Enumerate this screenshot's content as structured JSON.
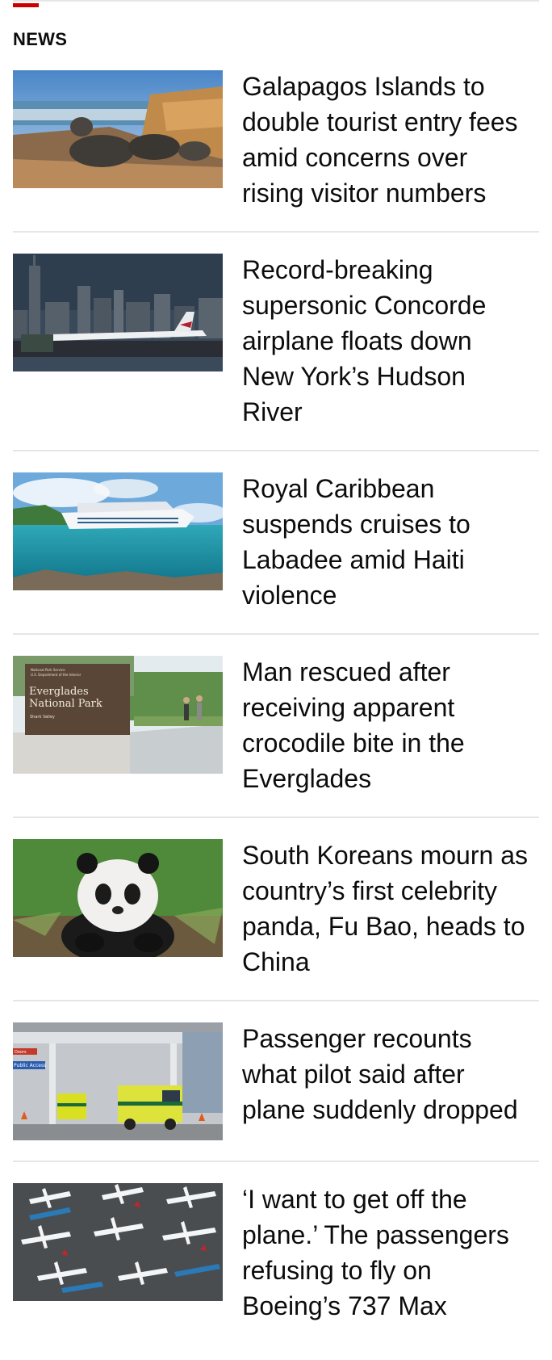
{
  "section": {
    "title": "NEWS",
    "accent_color": "#cc0000"
  },
  "articles": [
    {
      "headline": "Galapagos Islands to double tourist entry fees amid concerns over rising visitor numbers",
      "image": "iguanas-on-rocks-photo"
    },
    {
      "headline": "Record-breaking supersonic Concorde airplane floats down New York’s Hudson River",
      "image": "concorde-on-barge-photo"
    },
    {
      "headline": "Royal Caribbean suspends cruises to Labadee amid Haiti violence",
      "image": "cruise-ship-photo"
    },
    {
      "headline": "Man rescued after receiving apparent crocodile bite in the Everglades",
      "image": "everglades-sign-photo",
      "image_sign": {
        "small_line_1": "National Park Service",
        "small_line_2": "U.S. Department of the Interior",
        "name_line_1": "Everglades",
        "name_line_2": "National Park",
        "sub": "Shark Valley"
      }
    },
    {
      "headline": "South Koreans mourn as country’s first celebrity panda, Fu Bao, heads to China",
      "image": "panda-photo"
    },
    {
      "headline": "Passenger recounts what pilot said after plane suddenly dropped",
      "image": "ambulances-at-hangar-photo",
      "image_sign": {
        "sign_1": "Public Access",
        "sign_2": "Doors"
      }
    },
    {
      "headline": "‘I want to get off the plane.’ The passengers refusing to fly on Boeing’s 737 Max",
      "image": "parked-planes-aerial-photo"
    }
  ]
}
